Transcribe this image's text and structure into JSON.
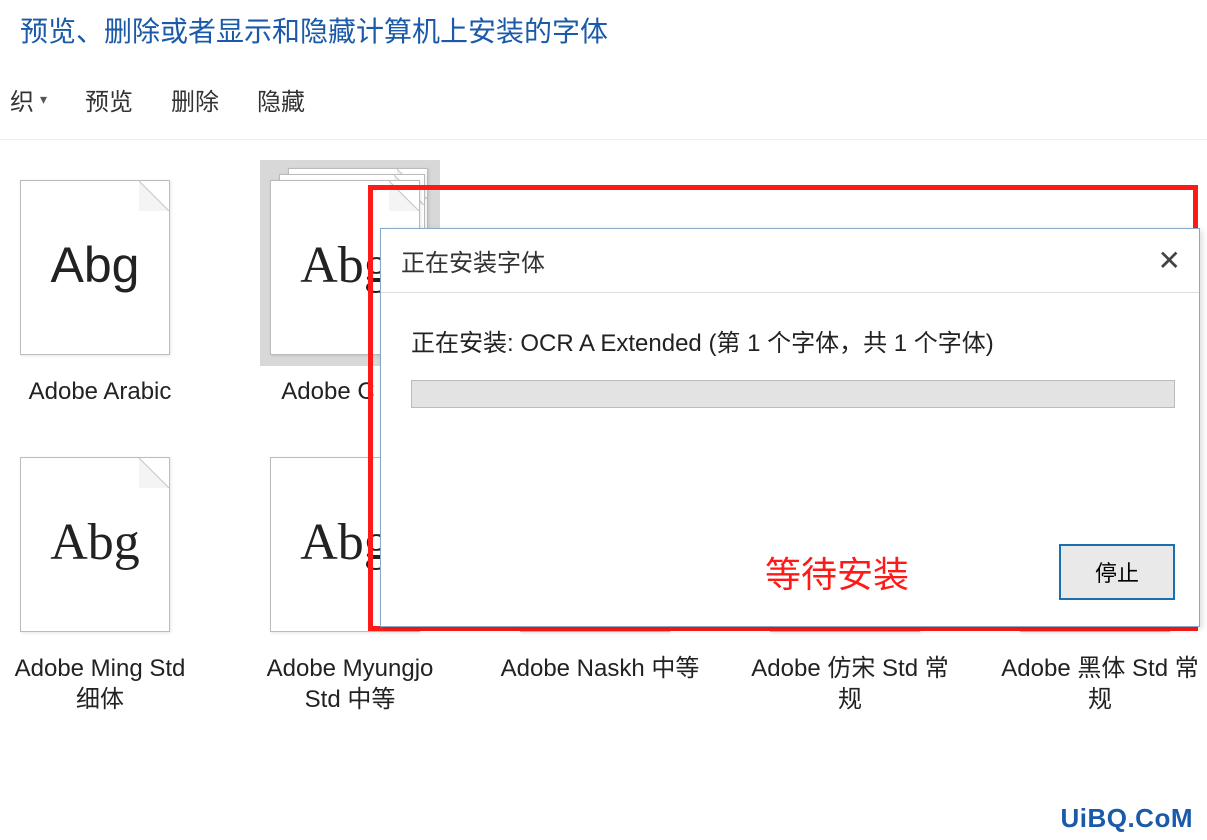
{
  "header": {
    "title": "预览、删除或者显示和隐藏计算机上安装的字体"
  },
  "toolbar": {
    "organize": "织",
    "preview": "预览",
    "delete": "删除",
    "hide": "隐藏"
  },
  "fonts_row1": [
    {
      "name": "Adobe Arabic",
      "sample": "Abg",
      "stack": false,
      "sans": true
    },
    {
      "name": "Adobe Caslon Pro",
      "sample": "Abg",
      "stack": true,
      "sans": false,
      "partial": "Adobe C\nPro"
    }
  ],
  "fonts_row2": [
    {
      "name": "Adobe Ming Std 细体",
      "sample": "Abg",
      "stack": false,
      "sans": false
    },
    {
      "name": "Adobe Myungjo Std 中等",
      "sample": "Abg",
      "stack": false,
      "sans": false
    },
    {
      "name": "Adobe Naskh 中等",
      "sample": "",
      "stack": false,
      "sans": false
    },
    {
      "name": "Adobe 仿宋 Std 常规",
      "sample": "",
      "stack": false,
      "sans": false
    },
    {
      "name": "Adobe 黑体 Std 常规",
      "sample": "",
      "stack": false,
      "sans": false
    }
  ],
  "dialog": {
    "title": "正在安装字体",
    "message": "正在安装: OCR A Extended (第 1 个字体，共 1 个字体)",
    "annotation": "等待安装",
    "stop": "停止",
    "close_glyph": "✕"
  },
  "watermark": "UiBQ.CoM"
}
